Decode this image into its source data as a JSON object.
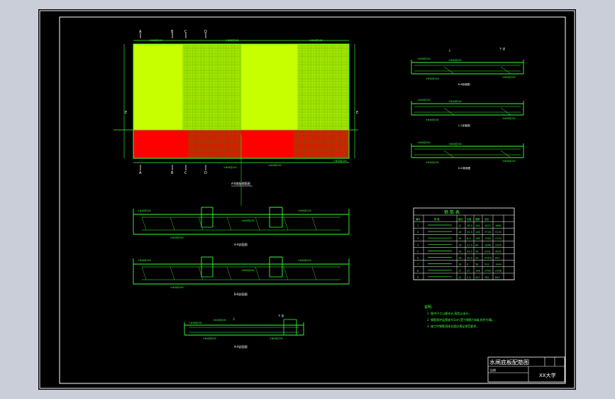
{
  "drawing": {
    "section_plan_label": "A-B底板钢筋图",
    "section_labels": [
      "A-A剖面图",
      "B-B剖面图",
      "C-C剖面图",
      "D-D剖面图"
    ],
    "axis_letters": [
      "A",
      "B",
      "C",
      "D"
    ],
    "top_label": "上",
    "side_label": "下 游",
    "bar_callouts": [
      "①Φ16@200",
      "②Φ16@200",
      "③Φ16@200",
      "④Φ16@200"
    ]
  },
  "table": {
    "title": "钢 筋 表",
    "headers": [
      "编号",
      "简 图",
      "直径",
      "长度",
      "根数",
      "总长"
    ],
    "rows": [
      [
        "1",
        "",
        "12",
        "18.0",
        "104",
        "1872",
        "1662"
      ],
      [
        "2",
        "",
        "16",
        "34.5",
        "108",
        "3726",
        "5130"
      ],
      [
        "3",
        "",
        "16",
        "8.0",
        "168",
        "1344",
        "2124"
      ],
      [
        "4",
        "",
        "16",
        "22.0",
        "84",
        "1848",
        "2920"
      ],
      [
        "5",
        "",
        "18",
        "34.5",
        "58",
        "2001",
        "4002"
      ],
      [
        "6",
        "",
        "18",
        "16.5",
        "29",
        "478.5",
        "957"
      ],
      [
        "7",
        "",
        "18",
        "9",
        "58",
        "522",
        "1044"
      ],
      [
        "8",
        "",
        "12",
        "25",
        "108",
        "2700",
        "2398"
      ],
      [
        "9",
        "",
        "12",
        "3.3",
        "257",
        "781",
        "843"
      ]
    ]
  },
  "notes": {
    "heading": "说明:",
    "lines": [
      "1. 图中尺寸以厘米计,高程以米计。",
      "2. 钢筋保护层厚度为5cm,受力钢筋为II级,其余为I级。",
      "3. 施工时钢筋搭接长度应满足规范要求。"
    ]
  },
  "title_block": {
    "title": "水闸底板配筋图",
    "scale": "比例",
    "drawing_no": "X X 水 平",
    "school": "XX大学"
  },
  "colors": {
    "background": "#000000",
    "line": "#39ff39",
    "yellow_fill": "#c7ff00",
    "red_fill": "#ff0000",
    "border": "#ffffff"
  }
}
